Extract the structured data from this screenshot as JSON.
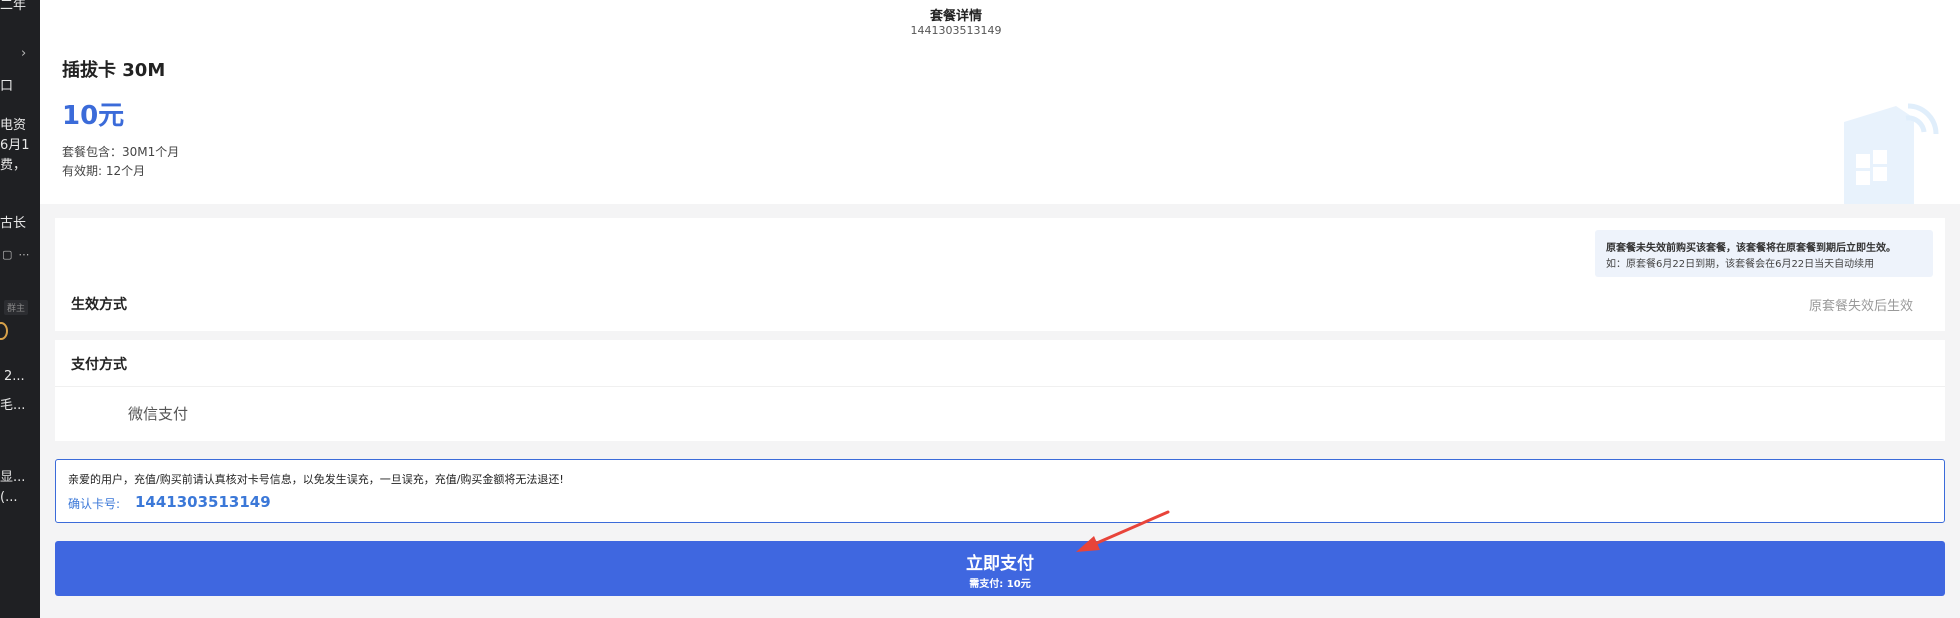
{
  "sidebar": {
    "fragments": [
      "二年",
      "口",
      "电资",
      "6月1",
      "费，",
      "古长",
      "2...",
      "毛...",
      "显...",
      "(..."
    ],
    "tag": "群主"
  },
  "header": {
    "title": "套餐详情",
    "card_number": "1441303513149"
  },
  "plan": {
    "name": "插拔卡 30M",
    "price": "10元",
    "contents": "套餐包含：30M1个月",
    "validity": "有效期: 12个月"
  },
  "effect": {
    "notice_line1": "原套餐未失效前购买该套餐，该套餐将在原套餐到期后立即生效。",
    "notice_line2": "如：原套餐6月22日到期，该套餐会在6月22日当天自动续用",
    "label": "生效方式",
    "value": "原套餐失效后生效"
  },
  "payment": {
    "label": "支付方式",
    "option": "微信支付"
  },
  "warning": {
    "text": "亲爱的用户，充值/购买前请认真核对卡号信息，以免发生误充，一旦误充，充值/购买金额将无法退还!",
    "confirm_label": "确认卡号:",
    "confirm_number": "1441303513149"
  },
  "pay_button": {
    "label": "立即支付",
    "amount": "需支付: 10元"
  },
  "colors": {
    "accent": "#3f67e0",
    "price": "#3b6bd9",
    "annotation_arrow": "#e8443a"
  }
}
